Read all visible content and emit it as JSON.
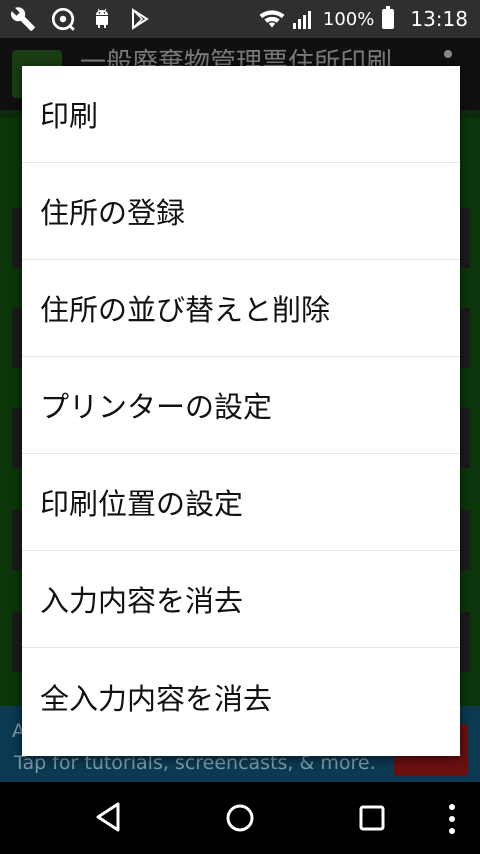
{
  "status_bar": {
    "battery_percent": "100%",
    "time": "13:18",
    "notification_icons": [
      "wrench-icon",
      "sync-icon",
      "android-icon",
      "play-store-icon"
    ]
  },
  "app": {
    "title": "一般廃棄物管理票住所印刷",
    "ad_banner": {
      "line1": "A",
      "line2": "Tap for tutorials, screencasts, & more."
    }
  },
  "menu": {
    "items": [
      {
        "label": "印刷"
      },
      {
        "label": "住所の登録"
      },
      {
        "label": "住所の並び替えと削除"
      },
      {
        "label": "プリンターの設定"
      },
      {
        "label": "印刷位置の設定"
      },
      {
        "label": "入力内容を消去"
      },
      {
        "label": "全入力内容を消去"
      }
    ]
  },
  "nav": {
    "back": "back-icon",
    "home": "home-icon",
    "recents": "recents-icon",
    "more": "more-vert-icon"
  }
}
